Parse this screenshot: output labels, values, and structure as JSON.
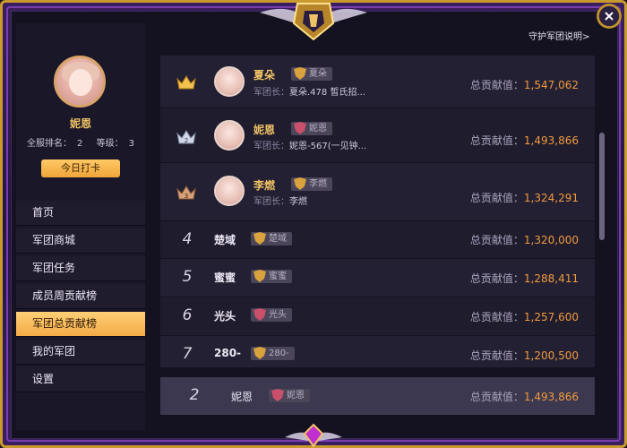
{
  "help_link": "守护军团说明>",
  "profile": {
    "name": "妮恩",
    "server_rank_label": "全服排名：",
    "server_rank": "2",
    "level_label": "等级：",
    "level": "3",
    "checkin_label": "今日打卡"
  },
  "menu": [
    {
      "label": "首页",
      "active": false
    },
    {
      "label": "军团商城",
      "active": false
    },
    {
      "label": "军团任务",
      "active": false
    },
    {
      "label": "成员周贡献榜",
      "active": false
    },
    {
      "label": "军团总贡献榜",
      "active": true
    },
    {
      "label": "我的军团",
      "active": false
    },
    {
      "label": "设置",
      "active": false
    }
  ],
  "ranking": {
    "leader_label": "军团长：",
    "contrib_label": "总贡献值：",
    "rows": [
      {
        "rank": "1",
        "name": "夏朵",
        "badge": "夏朵",
        "leader": "夏朵.478 皙氏招...",
        "value": "1,547,062",
        "crown": "gold"
      },
      {
        "rank": "2",
        "name": "妮恩",
        "badge": "妮恩",
        "leader": "妮恩-567(一见钟...",
        "value": "1,493,866",
        "crown": "silver"
      },
      {
        "rank": "3",
        "name": "李燃",
        "badge": "李燃",
        "leader": "李燃",
        "value": "1,324,291",
        "crown": "bronze"
      },
      {
        "rank": "4",
        "name": "楚域",
        "badge": "楚域",
        "value": "1,320,000"
      },
      {
        "rank": "5",
        "name": "蜜蜜",
        "badge": "蜜蜜",
        "value": "1,288,411"
      },
      {
        "rank": "6",
        "name": "光头",
        "badge": "光头",
        "value": "1,257,600"
      },
      {
        "rank": "7",
        "name": "280-",
        "badge": "280-",
        "value": "1,200,500"
      }
    ],
    "self": {
      "rank": "2",
      "name": "妮恩",
      "badge": "妮恩",
      "value": "1,493,866"
    }
  },
  "colors": {
    "gold": "#f0c266",
    "accent": "#f09a3e",
    "frame": "#c99a2e",
    "purple": "#7a3fae"
  }
}
